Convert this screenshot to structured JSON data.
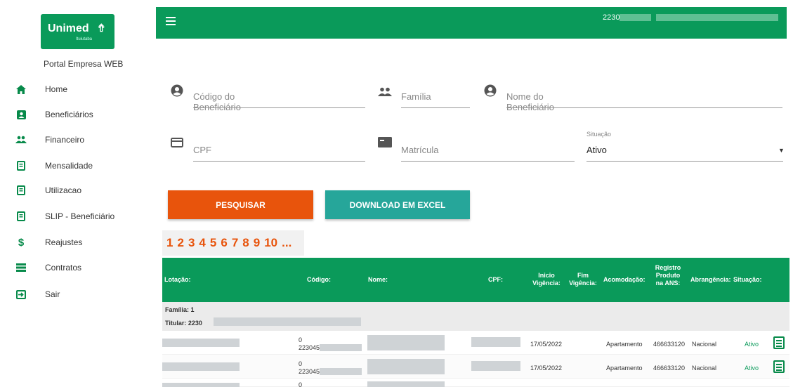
{
  "brand": {
    "name": "Unimed",
    "sub": "Ituiutaba",
    "portal_title": "Portal Empresa WEB",
    "accent": "#0a9a5a",
    "orange": "#e8540c",
    "teal": "#26a69a"
  },
  "sidebar": {
    "items": [
      {
        "label": "Home",
        "icon": "home-icon"
      },
      {
        "label": "Beneficiários",
        "icon": "person-card-icon"
      },
      {
        "label": "Financeiro",
        "icon": "people-icon"
      },
      {
        "label": "Mensalidade",
        "icon": "document-list-icon"
      },
      {
        "label": "Utilizacao",
        "icon": "document-list-icon"
      },
      {
        "label": "SLIP - Beneficiário",
        "icon": "document-list-icon"
      },
      {
        "label": "Reajustes",
        "icon": "dollar-icon"
      },
      {
        "label": "Contratos",
        "icon": "stack-icon"
      },
      {
        "label": "Sair",
        "icon": "exit-icon"
      }
    ]
  },
  "topbar": {
    "user": "2230"
  },
  "form": {
    "codigo_placeholder": "Código do Beneficiário",
    "familia_placeholder": "Família",
    "nome_placeholder": "Nome do Beneficiário",
    "cpf_placeholder": "CPF",
    "matricula_placeholder": "Matrícula",
    "situacao_label": "Situação",
    "situacao_value": "Ativo"
  },
  "buttons": {
    "search": "PESQUISAR",
    "excel": "DOWNLOAD EM EXCEL"
  },
  "pager": {
    "pages": [
      "1",
      "2",
      "3",
      "4",
      "5",
      "6",
      "7",
      "8",
      "9",
      "10",
      "..."
    ]
  },
  "table": {
    "headers": {
      "lotacao": "Lotação:",
      "codigo": "Código:",
      "nome": "Nome:",
      "cpf": "CPF:",
      "inicio": "Inicio Vigência:",
      "fim": "Fim Vigência:",
      "acomodacao": "Acomodação:",
      "registro": "Registro Produto na ANS:",
      "abrangencia": "Abrangência:",
      "situacao": "Situação:"
    },
    "group": {
      "familia": "Família: 1",
      "titular": "Titular: 2230"
    },
    "rows": [
      {
        "codigo_top": "0",
        "codigo": "223045",
        "inicio": "17/05/2022",
        "acomodacao": "Apartamento",
        "registro": "466633120",
        "abrangencia": "Nacional",
        "situacao": "Ativo"
      },
      {
        "codigo_top": "0",
        "codigo": "223045",
        "inicio": "17/05/2022",
        "acomodacao": "Apartamento",
        "registro": "466633120",
        "abrangencia": "Nacional",
        "situacao": "Ativo"
      },
      {
        "codigo_top": "0"
      }
    ]
  }
}
